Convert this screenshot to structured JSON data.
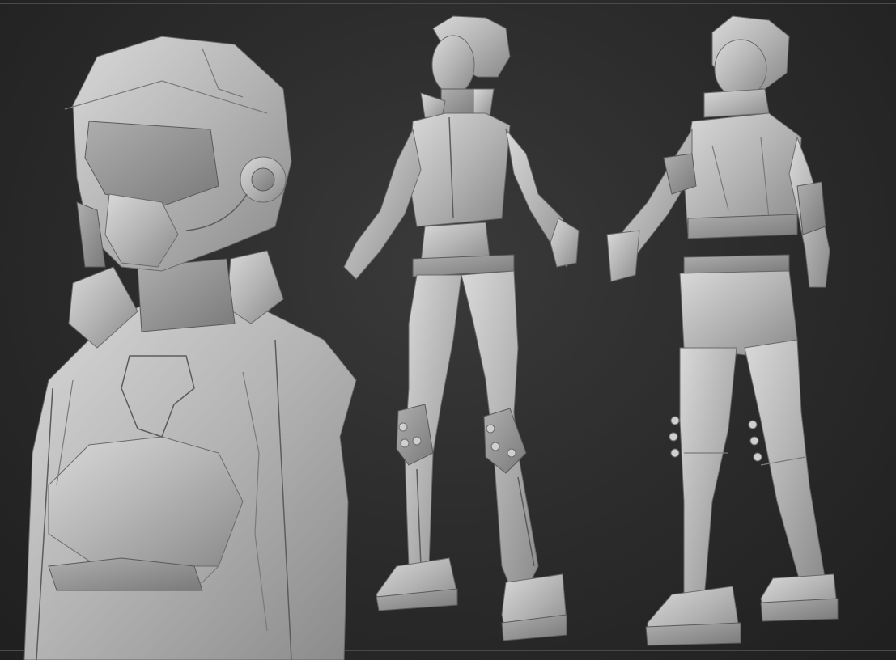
{
  "scene": {
    "background_color": "#2d2d2d",
    "clay_color": "#b9b9b9",
    "views": [
      {
        "id": "bust-closeup",
        "description_icon": "helmet-bust"
      },
      {
        "id": "front-three-quarter",
        "description_icon": "full-body-front"
      },
      {
        "id": "back-three-quarter",
        "description_icon": "full-body-back"
      }
    ]
  }
}
